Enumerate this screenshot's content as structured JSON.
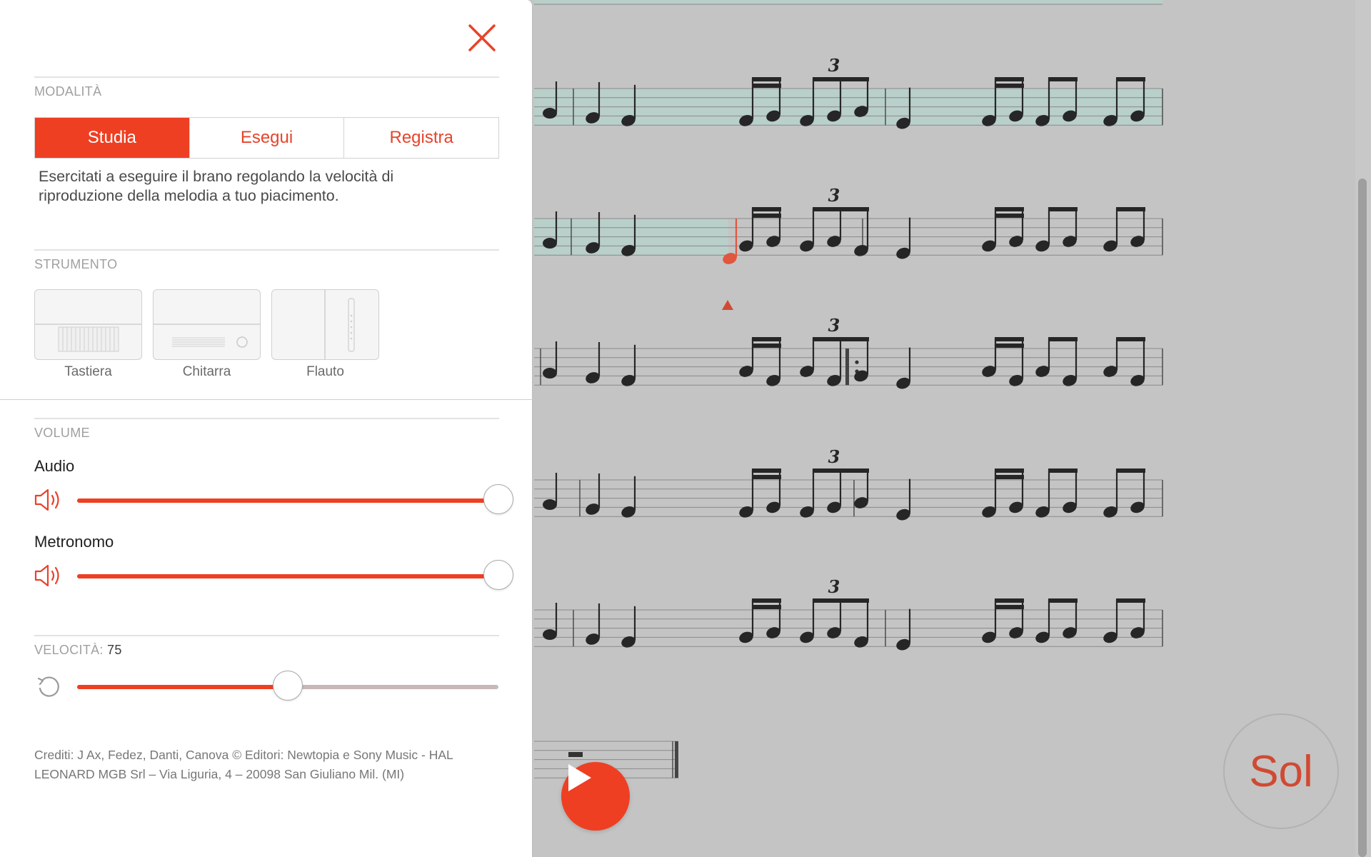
{
  "panel": {
    "close_icon": "close-x-icon",
    "mode": {
      "section_label": "MODALITÀ",
      "tabs": [
        {
          "label": "Studia",
          "active": true
        },
        {
          "label": "Esegui",
          "active": false
        },
        {
          "label": "Registra",
          "active": false
        }
      ],
      "description": "Esercitati a eseguire il brano regolando la velocità di riproduzione della melodia a tuo piacimento."
    },
    "instrument": {
      "section_label": "STRUMENTO",
      "items": [
        {
          "label": "Tastiera",
          "icon": "keyboard-icon"
        },
        {
          "label": "Chitarra",
          "icon": "guitar-icon"
        },
        {
          "label": "Flauto",
          "icon": "flute-icon"
        }
      ]
    },
    "volume": {
      "section_label": "VOLUME",
      "audio": {
        "label": "Audio",
        "icon": "speaker-icon",
        "level": 1.0
      },
      "metronome": {
        "label": "Metronomo",
        "icon": "speaker-icon",
        "level": 1.0
      }
    },
    "speed": {
      "section_label": "VELOCITÀ:",
      "value": "75",
      "level": 0.5,
      "reset_icon": "reset-icon"
    },
    "credits": "Crediti: J Ax, Fedez, Danti, Canova © Editori: Newtopia e Sony Music - HAL LEONARD MGB Srl – Via Liguria, 4 – 20098 San Giuliano Mil. (MI)"
  },
  "score": {
    "tuplet_label": "3",
    "current_note": "Sol",
    "play_icon": "play-icon",
    "colors": {
      "accent": "#ee3f23",
      "highlight": "#b9cfc9",
      "background": "#c4c4c4"
    }
  }
}
